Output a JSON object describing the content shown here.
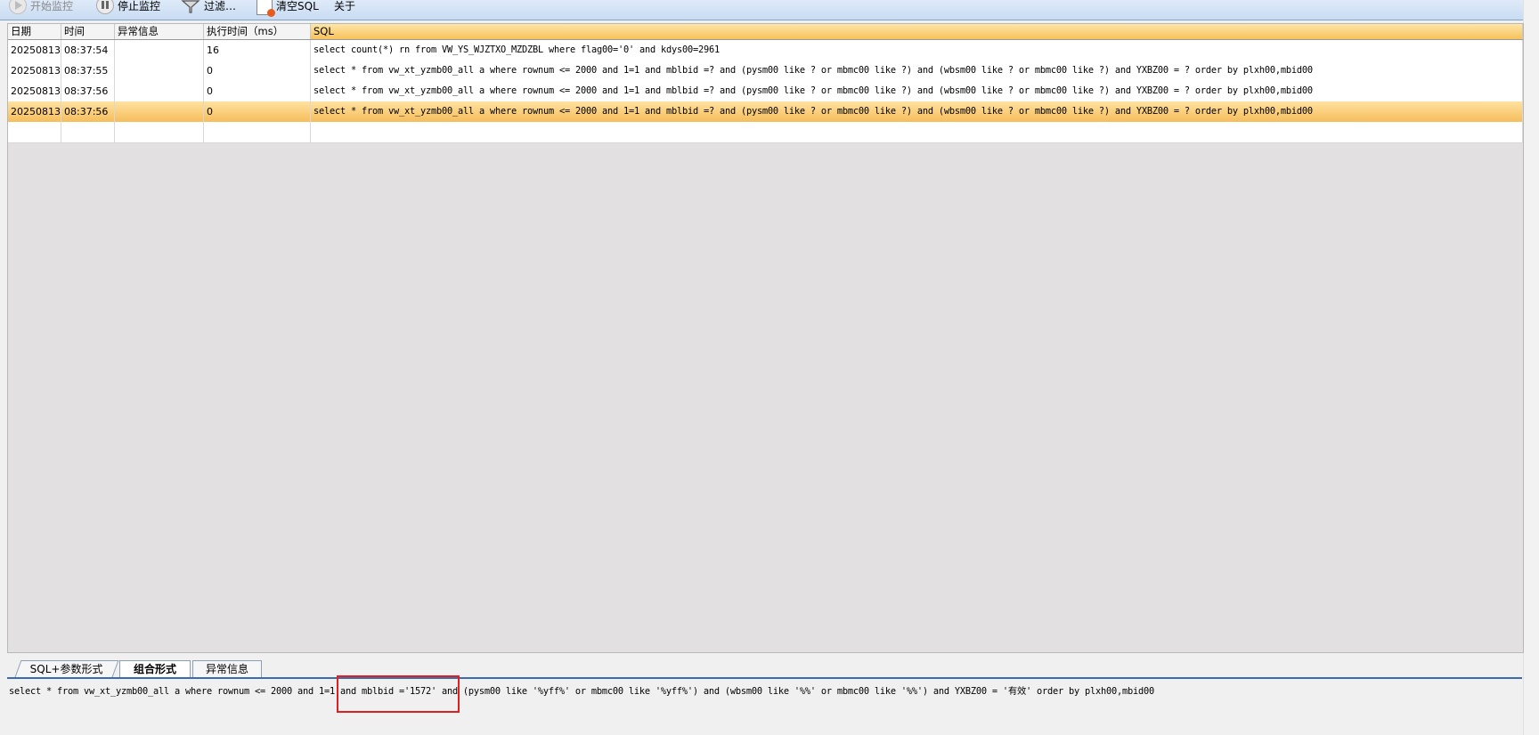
{
  "toolbar": {
    "start_label": "开始监控",
    "stop_label": "停止监控",
    "filter_label": "过滤…",
    "clear_label": "清空SQL",
    "about_label": "关于"
  },
  "grid": {
    "columns": [
      "日期",
      "时间",
      "异常信息",
      "执行时间（ms）",
      "SQL"
    ],
    "rows": [
      {
        "date": "20250813",
        "time": "08:37:54",
        "error": "",
        "ms": "16",
        "sql": "select count(*) rn from VW_YS_WJZTXO_MZDZBL where flag00='0' and kdys00=2961"
      },
      {
        "date": "20250813",
        "time": "08:37:55",
        "error": "",
        "ms": "0",
        "sql": "select * from vw_xt_yzmb00_all a where rownum <= 2000 and  1=1  and mblbid =?  and (pysm00 like ? or mbmc00 like ?) and (wbsm00 like ? or mbmc00 like ?) and YXBZ00 = ? order by plxh00,mbid00"
      },
      {
        "date": "20250813",
        "time": "08:37:56",
        "error": "",
        "ms": "0",
        "sql": "select * from vw_xt_yzmb00_all a where rownum <= 2000 and  1=1  and mblbid =?  and (pysm00 like ? or mbmc00 like ?) and (wbsm00 like ? or mbmc00 like ?) and YXBZ00 = ? order by plxh00,mbid00"
      },
      {
        "date": "20250813",
        "time": "08:37:56",
        "error": "",
        "ms": "0",
        "sql": "select * from vw_xt_yzmb00_all a where rownum <= 2000 and  1=1  and mblbid =?  and (pysm00 like ? or mbmc00 like ?) and (wbsm00 like ? or mbmc00 like ?) and YXBZ00 = ? order by plxh00,mbid00"
      }
    ]
  },
  "tabs": [
    "SQL+参数形式",
    "组合形式",
    "异常信息"
  ],
  "detail": {
    "sql": "select * from vw_xt_yzmb00_all a where rownum <= 2000 and  1=1  and mblbid ='1572'  and (pysm00 like '%yff%' or mbmc00 like '%yff%') and (wbsm00 like '%%' or mbmc00 like '%%') and YXBZ00 = '有效' order by plxh00,mbid00"
  }
}
